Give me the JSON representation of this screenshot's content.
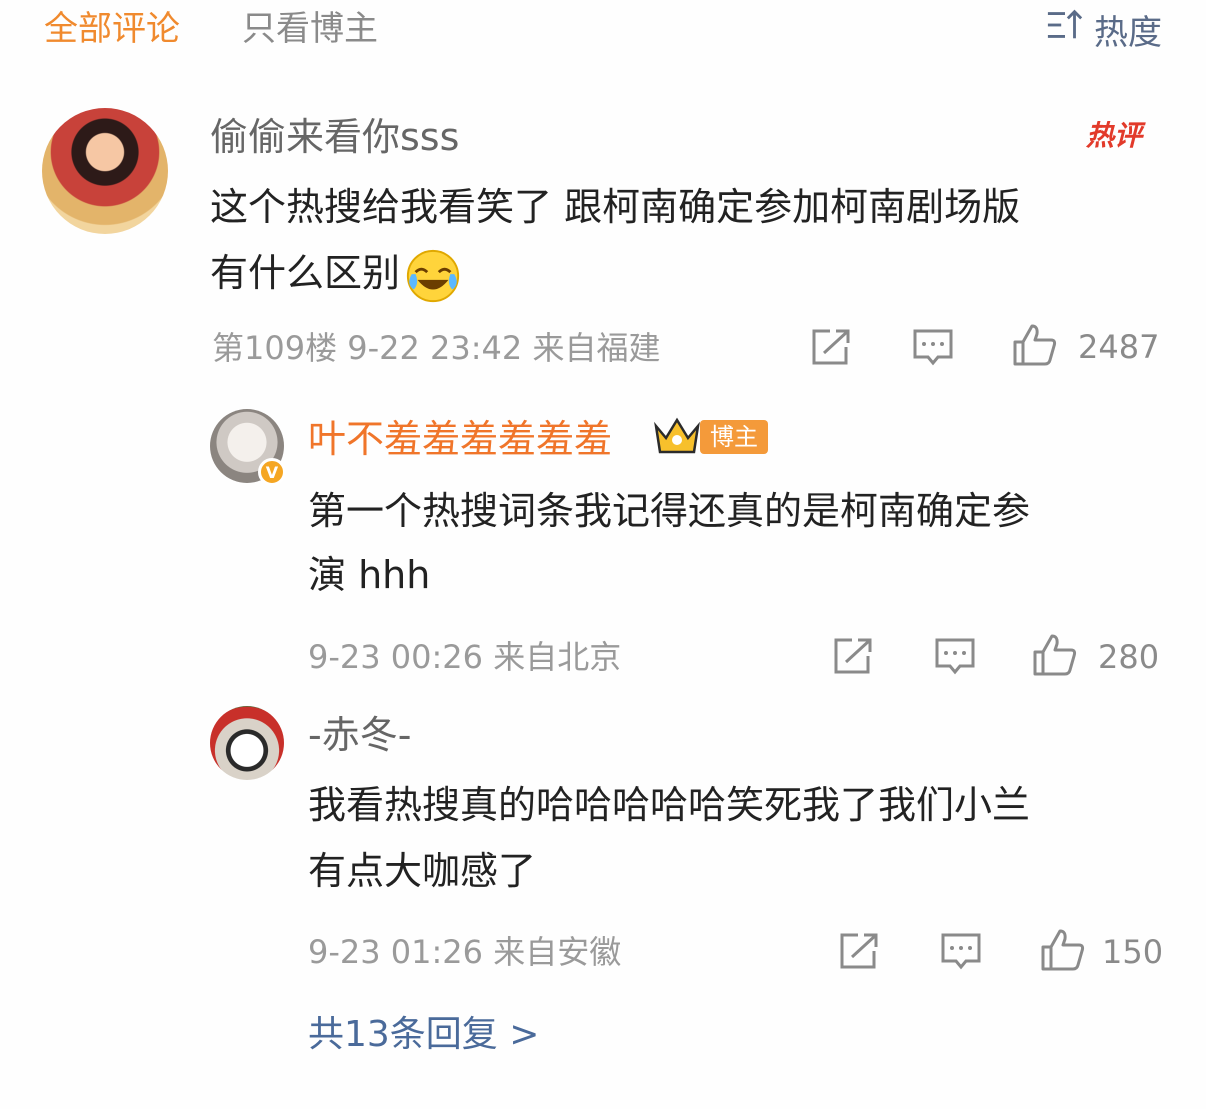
{
  "tabs": {
    "all": "全部评论",
    "host_only": "只看博主"
  },
  "sort": {
    "label": "热度",
    "icon": "sort-icon"
  },
  "comment": {
    "username": "偷偷来看你sss",
    "badge": "热评",
    "text_line1": "这个热搜给我看笑了 跟柯南确定参加柯南剧场版",
    "text_line2": "有什么区别",
    "emoji": "laughing-tears-emoji",
    "meta": "第109楼 9-22 23:42 来自福建",
    "likes": "2487"
  },
  "replies": [
    {
      "username": "叶不羞羞羞羞羞羞",
      "author_badge": "博主",
      "verified": "V",
      "text_line1": "第一个热搜词条我记得还真的是柯南确定参",
      "text_line2": "演 hhh",
      "meta": "9-23 00:26 来自北京",
      "likes": "280"
    },
    {
      "username": "-赤冬-",
      "text_line1": "我看热搜真的哈哈哈哈哈笑死我了我们小兰",
      "text_line2": "有点大咖感了",
      "meta": "9-23 01:26 来自安徽",
      "likes": "150"
    }
  ],
  "more_replies": "共13条回复 >",
  "colors": {
    "accent": "#f08a2e",
    "link": "#4a6a9a",
    "hot": "#e23a2a"
  }
}
